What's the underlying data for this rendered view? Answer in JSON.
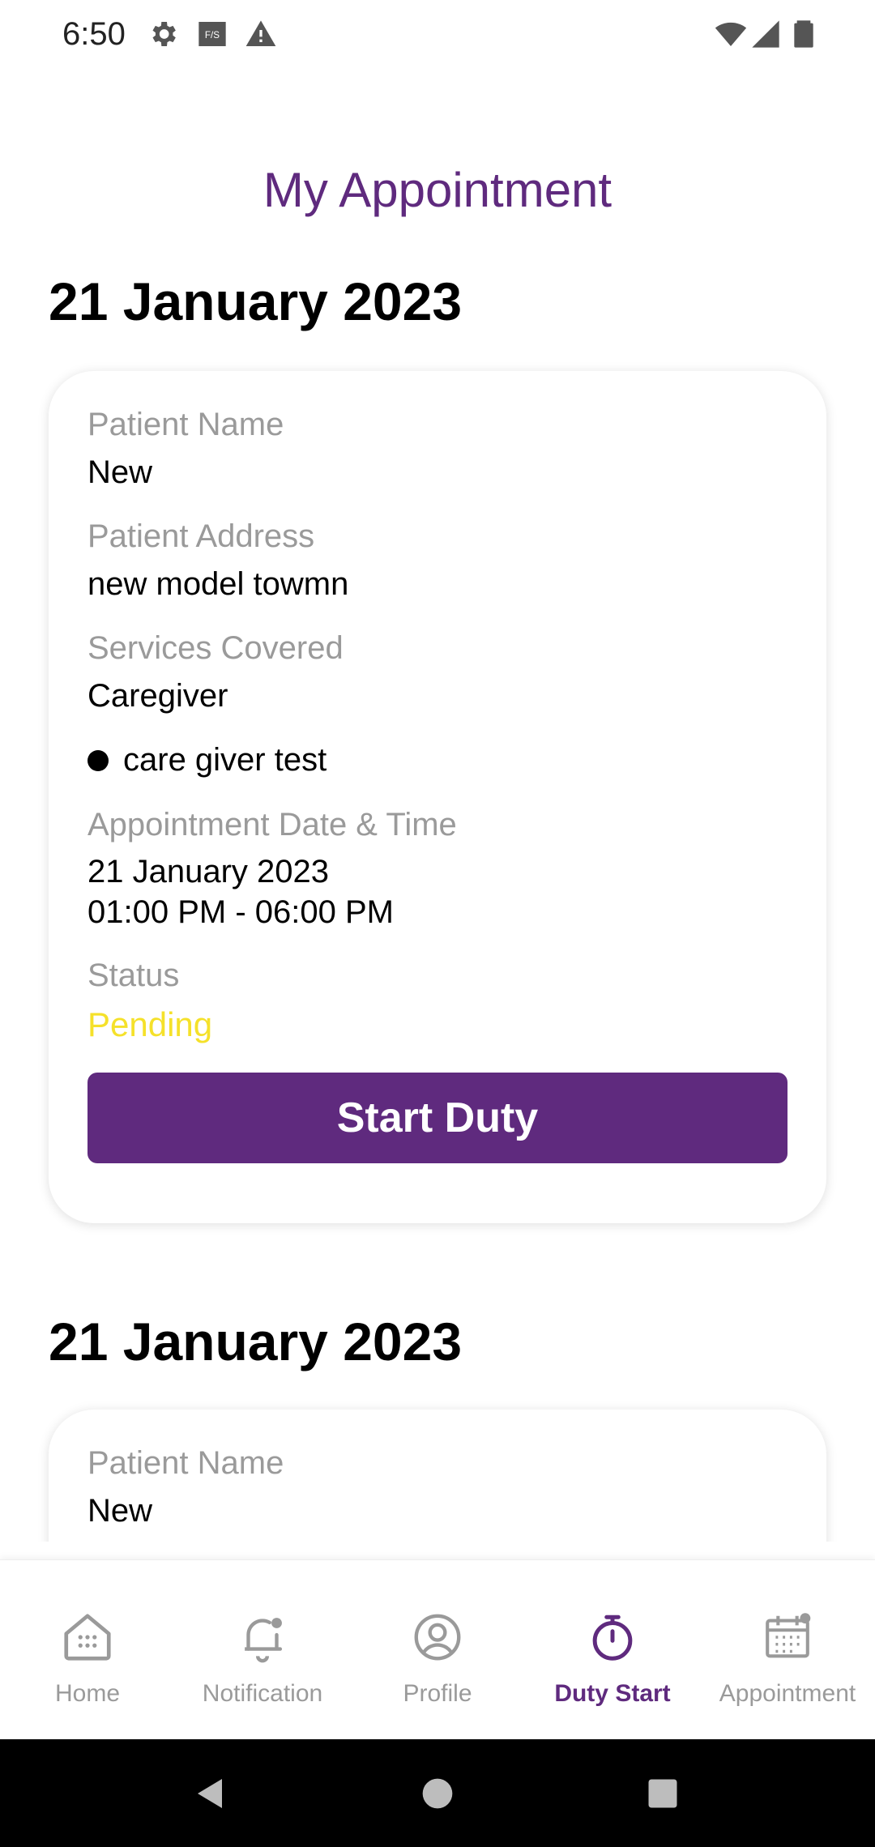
{
  "status_bar": {
    "time": "6:50",
    "left_icons": [
      "settings-icon",
      "fys-app-icon",
      "alert-icon"
    ],
    "right_icons": [
      "wifi-icon",
      "signal-icon",
      "battery-icon"
    ],
    "fys_badge": "F/S"
  },
  "page": {
    "title": "My Appointment"
  },
  "appointments": [
    {
      "date_heading": "21 January 2023",
      "patient_name_label": "Patient Name",
      "patient_name": "New",
      "patient_address_label": "Patient Address",
      "patient_address": "new model towmn",
      "services_label": "Services Covered",
      "service": "Caregiver",
      "sub_service": "care giver test",
      "datetime_label": "Appointment Date & Time",
      "date": "21 January 2023",
      "time_range": "01:00 PM - 06:00 PM",
      "status_label": "Status",
      "status": "Pending",
      "action_label": "Start Duty"
    },
    {
      "date_heading": "21 January 2023",
      "patient_name_label": "Patient Name",
      "patient_name": "New"
    }
  ],
  "bottom_nav": {
    "items": [
      {
        "label": "Home",
        "icon": "home-icon",
        "active": false
      },
      {
        "label": "Notification",
        "icon": "bell-icon",
        "active": false
      },
      {
        "label": "Profile",
        "icon": "user-circle-icon",
        "active": false
      },
      {
        "label": "Duty Start",
        "icon": "stopwatch-icon",
        "active": true
      },
      {
        "label": "Appointment",
        "icon": "calendar-icon",
        "active": false
      }
    ]
  },
  "colors": {
    "brand_purple": "#5f2a7e",
    "label_gray": "#9a9a9a",
    "status_pending": "#f5e12a"
  }
}
